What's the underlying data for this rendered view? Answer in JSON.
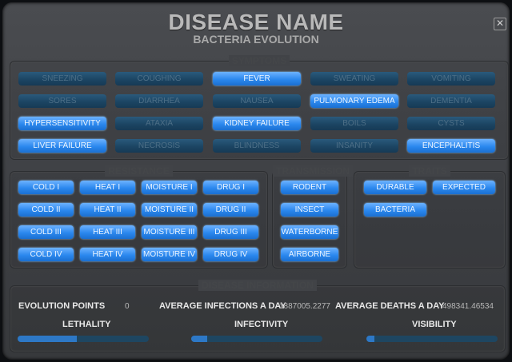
{
  "header": {
    "title": "DISEASE NAME",
    "subtitle": "BACTERIA EVOLUTION",
    "close": "✕"
  },
  "symptoms": {
    "title": "SYMPTOMS",
    "rows": [
      [
        {
          "label": "SNEEZING",
          "on": false
        },
        {
          "label": "COUGHING",
          "on": false
        },
        {
          "label": "FEVER",
          "on": true
        },
        {
          "label": "SWEATING",
          "on": false
        },
        {
          "label": "VOMITING",
          "on": false
        }
      ],
      [
        {
          "label": "SORES",
          "on": false
        },
        {
          "label": "DIARRHEA",
          "on": false
        },
        {
          "label": "NAUSEA",
          "on": false
        },
        {
          "label": "PULMONARY EDEMA",
          "on": true
        },
        {
          "label": "DEMENTIA",
          "on": false
        }
      ],
      [
        {
          "label": "HYPERSENSITIVITY",
          "on": true
        },
        {
          "label": "ATAXIA",
          "on": false
        },
        {
          "label": "KIDNEY FAILURE",
          "on": true
        },
        {
          "label": "BOILS",
          "on": false
        },
        {
          "label": "CYSTS",
          "on": false
        }
      ],
      [
        {
          "label": "LIVER FAILURE",
          "on": true
        },
        {
          "label": "NECROSIS",
          "on": false
        },
        {
          "label": "BLINDNESS",
          "on": false
        },
        {
          "label": "INSANITY",
          "on": false
        },
        {
          "label": "ENCEPHALITIS",
          "on": true
        }
      ]
    ]
  },
  "resistance": {
    "title": "RESISTANCE",
    "rows": [
      [
        "COLD I",
        "HEAT I",
        "MOISTURE I",
        "DRUG I"
      ],
      [
        "COLD II",
        "HEAT II",
        "MOISTURE II",
        "DRUG II"
      ],
      [
        "COLD III",
        "HEAT III",
        "MOISTURE III",
        "DRUG III"
      ],
      [
        "COLD IV",
        "HEAT IV",
        "MOISTURE IV",
        "DRUG IV"
      ]
    ]
  },
  "transmission": {
    "title": "TRANSMISSION",
    "items": [
      "RODENT",
      "INSECT",
      "WATERBORNE",
      "AIRBORNE"
    ]
  },
  "traits": {
    "title": "TRAITS",
    "items": [
      "DURABLE",
      "EXPECTED",
      "BACTERIA"
    ]
  },
  "info": {
    "title": "DISEASE INFORMATION",
    "evolution_points_label": "EVOLUTION POINTS",
    "evolution_points": "0",
    "avg_infections_label": "AVERAGE INFECTIONS A DAY",
    "avg_infections": "1887005.2277",
    "avg_deaths_label": "AVERAGE DEATHS A DAY",
    "avg_deaths": "498341.46534",
    "lethality_label": "LETHALITY",
    "infectivity_label": "INFECTIVITY",
    "visibility_label": "VISIBILITY",
    "lethality": 0.45,
    "infectivity": 0.12,
    "visibility": 0.06
  },
  "colors": {
    "active": "#2b88ee",
    "inactive": "#1c4563",
    "background": "#414347"
  }
}
